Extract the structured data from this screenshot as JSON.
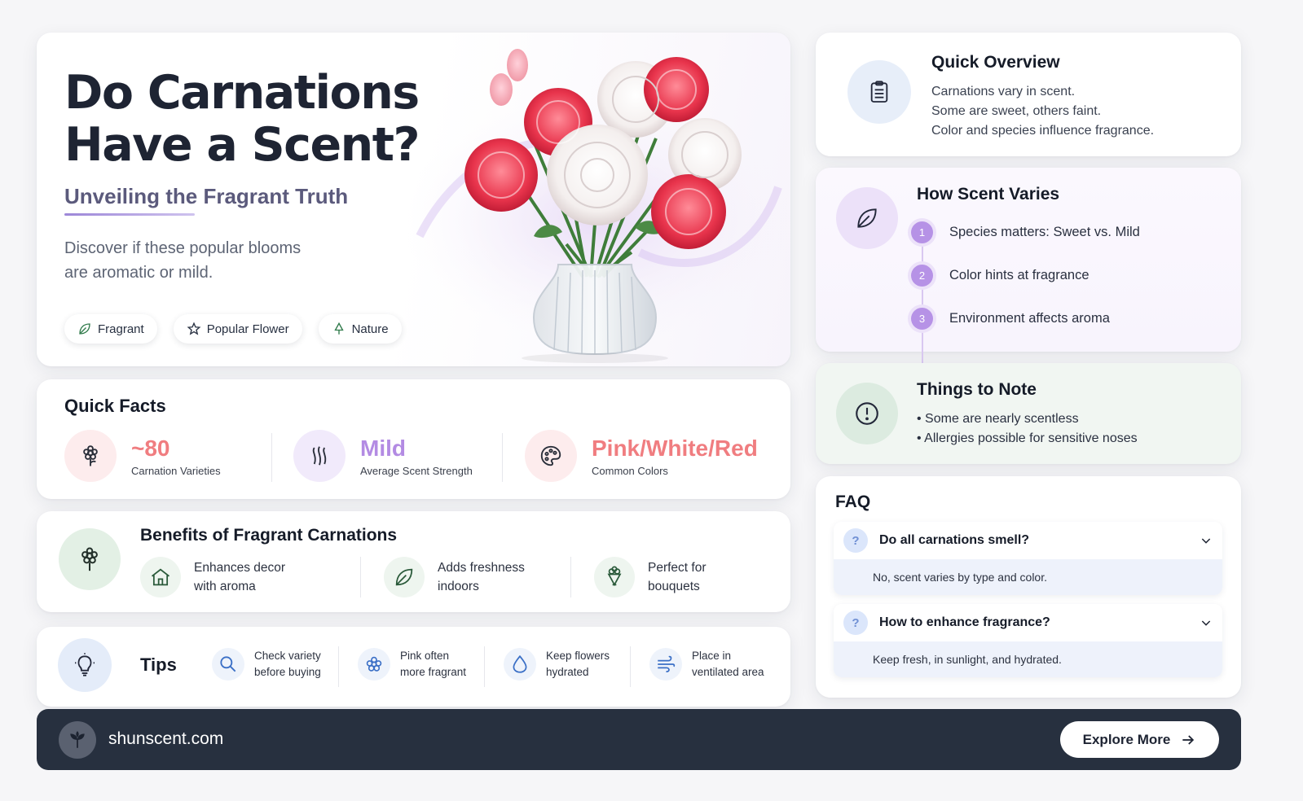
{
  "hero": {
    "title_line1": "Do Carnations",
    "title_line2": "Have a Scent?",
    "subtitle": "Unveiling the Fragrant Truth",
    "desc_line1": "Discover if these popular blooms",
    "desc_line2": "are aromatic or mild.",
    "tags": [
      {
        "label": "Fragrant",
        "icon": "leaf-icon"
      },
      {
        "label": "Popular Flower",
        "icon": "star-icon"
      },
      {
        "label": "Nature",
        "icon": "tree-icon"
      }
    ]
  },
  "facts": {
    "title": "Quick Facts",
    "items": [
      {
        "value": "~80",
        "label": "Carnation Varieties",
        "color": "#f07d80",
        "bg": "#fdeced",
        "icon": "flower-icon"
      },
      {
        "value": "Mild",
        "label": "Average Scent Strength",
        "color": "#b38be3",
        "bg": "#f1eafb",
        "icon": "scent-waves-icon"
      },
      {
        "value": "Pink/White/Red",
        "label": "Common Colors",
        "color": "#f07d80",
        "bg": "#fdeced",
        "icon": "palette-icon"
      }
    ]
  },
  "benefits": {
    "title": "Benefits of Fragrant Carnations",
    "items": [
      {
        "line1": "Enhances decor",
        "line2": "with aroma",
        "icon": "house-icon"
      },
      {
        "line1": "Adds freshness",
        "line2": "indoors",
        "icon": "leaf-icon"
      },
      {
        "line1": "Perfect for",
        "line2": "bouquets",
        "icon": "bouquet-icon"
      }
    ]
  },
  "tips": {
    "title": "Tips",
    "items": [
      {
        "line1": "Check variety",
        "line2": "before buying",
        "icon": "search-icon"
      },
      {
        "line1": "Pink often",
        "line2": "more fragrant",
        "icon": "flower-icon"
      },
      {
        "line1": "Keep flowers",
        "line2": "hydrated",
        "icon": "water-drop-icon"
      },
      {
        "line1": "Place in",
        "line2": "ventilated area",
        "icon": "wind-icon"
      }
    ]
  },
  "overview": {
    "title": "Quick Overview",
    "lines": [
      "Carnations vary in scent.",
      "Some are sweet, others faint.",
      "Color and species influence fragrance."
    ]
  },
  "varies": {
    "title": "How Scent Varies",
    "steps": [
      {
        "num": "1",
        "text": "Species matters: Sweet vs. Mild"
      },
      {
        "num": "2",
        "text": "Color hints at fragrance"
      },
      {
        "num": "3",
        "text": "Environment affects aroma"
      }
    ]
  },
  "note": {
    "title": "Things to Note",
    "bullets": [
      "• Some are nearly scentless",
      "• Allergies possible for sensitive noses"
    ]
  },
  "faq": {
    "title": "FAQ",
    "items": [
      {
        "q": "Do all carnations smell?",
        "a": "No, scent varies by type and color.",
        "mark": "?"
      },
      {
        "q": "How to enhance fragrance?",
        "a": "Keep fresh, in sunlight, and hydrated.",
        "mark": "?"
      }
    ]
  },
  "footer": {
    "site": "shunscent.com",
    "button": "Explore More"
  }
}
